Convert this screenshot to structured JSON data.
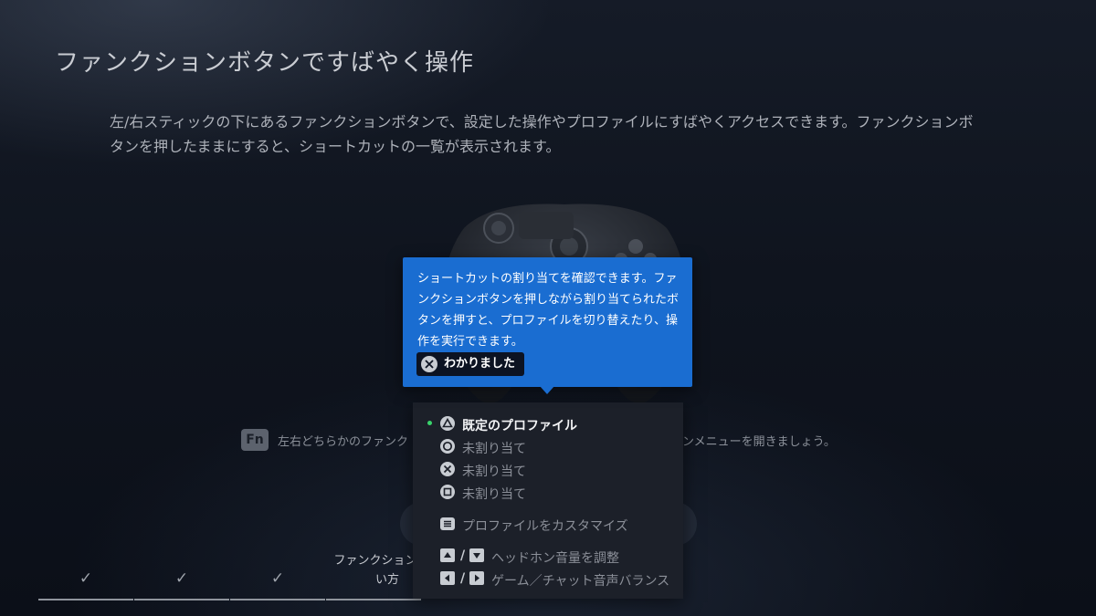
{
  "page": {
    "title": "ファンクションボタンですばやく操作",
    "description": "左/右スティックの下にあるファンクションボタンで、設定した操作やプロファイルにすばやくアクセスできます。ファンクションボタンを押したままにすると、ショートカットの一覧が表示されます。"
  },
  "fn_hint": {
    "badge": "Fn",
    "text_left": "左右どちらかのファンク",
    "text_right": "ョンメニューを開きましょう。"
  },
  "tooltip": {
    "text": "ショートカットの割り当てを確認できます。ファンクションボタンを押しながら割り当てられたボタンを押すと、プロファイルを切り替えたり、操作を実行できます。",
    "button_label": "わかりました",
    "button_icon": "cross-icon"
  },
  "menu": {
    "items": [
      {
        "icon": "triangle-icon",
        "label": "既定のプロファイル",
        "active": true
      },
      {
        "icon": "circle-icon",
        "label": "未割り当て"
      },
      {
        "icon": "cross-icon",
        "label": "未割り当て"
      },
      {
        "icon": "square-icon",
        "label": "未割り当て"
      }
    ],
    "customize": {
      "icon": "list-icon",
      "label": "プロファイルをカスタマイズ"
    },
    "volume": {
      "icons": [
        "dpad-up-icon",
        "dpad-down-icon"
      ],
      "separator": "/",
      "label": "ヘッドホン音量を調整"
    },
    "balance": {
      "icons": [
        "dpad-left-icon",
        "dpad-right-icon"
      ],
      "separator": "/",
      "label": "ゲーム／チャット音声バランス"
    }
  },
  "steps": {
    "items": [
      {
        "mark": "✓"
      },
      {
        "mark": "✓"
      },
      {
        "mark": "✓"
      },
      {
        "label": "ファンクションボタ\nい方"
      }
    ]
  },
  "colors": {
    "tooltip": "#1a6dd1",
    "active_dot": "#39d36b",
    "menu_bg": "#1c2029"
  }
}
